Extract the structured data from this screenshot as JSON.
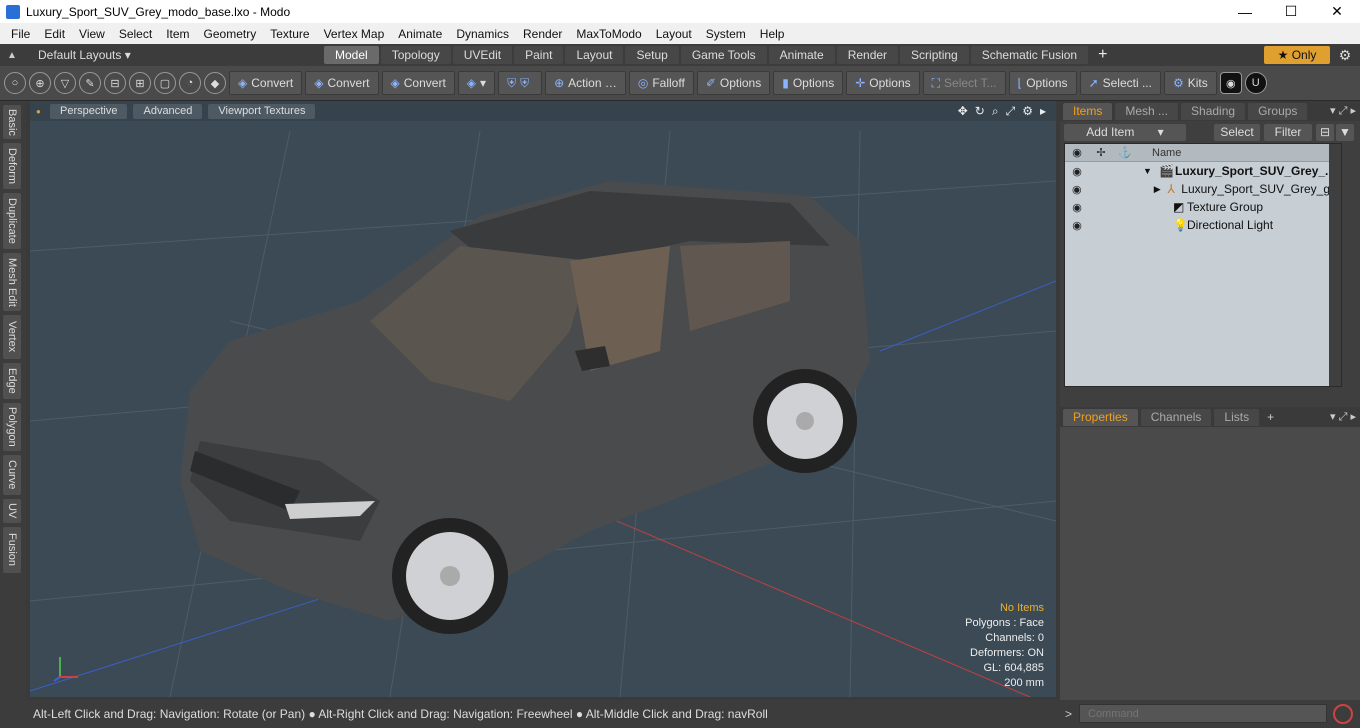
{
  "window": {
    "title": "Luxury_Sport_SUV_Grey_modo_base.lxo - Modo",
    "minimize": "—",
    "maximize": "☐",
    "close": "✕"
  },
  "menu": [
    "File",
    "Edit",
    "View",
    "Select",
    "Item",
    "Geometry",
    "Texture",
    "Vertex Map",
    "Animate",
    "Dynamics",
    "Render",
    "MaxToModo",
    "Layout",
    "System",
    "Help"
  ],
  "layoutbar": {
    "layouts_label": "Default Layouts ▾",
    "tabs": [
      "Model",
      "Topology",
      "UVEdit",
      "Paint",
      "Layout",
      "Setup",
      "Game Tools",
      "Animate",
      "Render",
      "Scripting",
      "Schematic Fusion"
    ],
    "active_tab": "Model",
    "only_label": "★  Only",
    "accent": "#e0a030"
  },
  "toolbar": {
    "convert1": "Convert",
    "convert2": "Convert",
    "convert3": "Convert",
    "action": "Action",
    "falloff": "Falloff",
    "options1": "Options",
    "options2": "Options",
    "options3": "Options",
    "options4": "Options",
    "select_t": "Select T...",
    "selecti": "Selecti ...",
    "kits": "Kits"
  },
  "lefttabs": [
    "Basic",
    "Deform",
    "Duplicate",
    "Mesh Edit",
    "Vertex",
    "Edge",
    "Polygon",
    "Curve",
    "UV",
    "Fusion"
  ],
  "viewport": {
    "perspective": "Perspective",
    "advanced": "Advanced",
    "textures": "Viewport Textures",
    "stats": {
      "no_items": "No Items",
      "polygons": "Polygons : Face",
      "channels": "Channels: 0",
      "deformers": "Deformers: ON",
      "gl": "GL: 604,885",
      "scale": "200 mm"
    }
  },
  "items_panel": {
    "tabs": [
      "Items",
      "Mesh ...",
      "Shading",
      "Groups"
    ],
    "add_item": "Add Item",
    "select": "Select",
    "filter": "Filter",
    "name_header": "Name",
    "rows": [
      {
        "label": "Luxury_Sport_SUV_Grey_...",
        "bold": true
      },
      {
        "label": "Luxury_Sport_SUV_Grey_gr...",
        "bold": false
      },
      {
        "label": "Texture Group",
        "bold": false
      },
      {
        "label": "Directional Light",
        "bold": false
      }
    ]
  },
  "props_panel": {
    "tabs": [
      "Properties",
      "Channels",
      "Lists"
    ]
  },
  "status": {
    "hint": "Alt-Left Click and Drag: Navigation: Rotate (or Pan) ● Alt-Right Click and Drag: Navigation: Freewheel ● Alt-Middle Click and Drag: navRoll",
    "command_placeholder": "Command"
  }
}
